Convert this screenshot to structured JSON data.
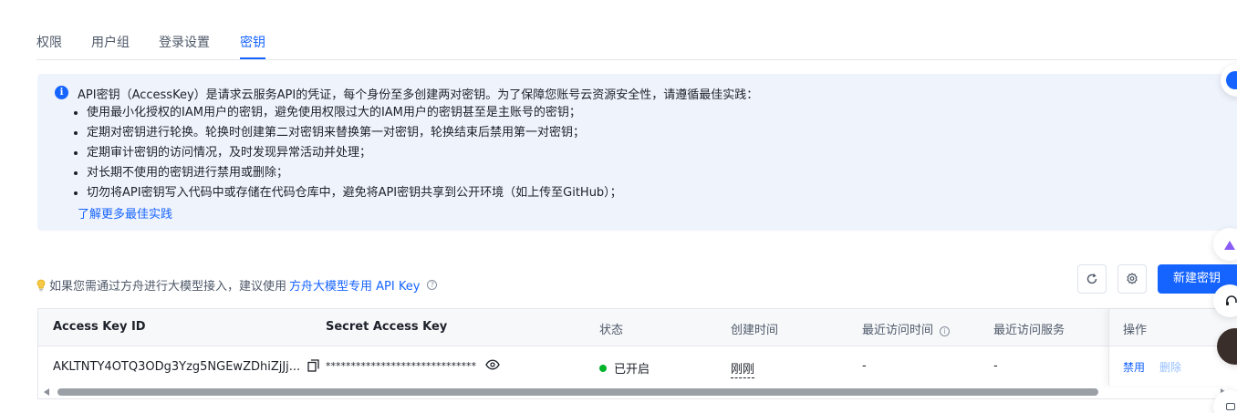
{
  "tabs": [
    {
      "label": "权限"
    },
    {
      "label": "用户组"
    },
    {
      "label": "登录设置"
    },
    {
      "label": "密钥"
    }
  ],
  "info": {
    "title": "API密钥（AccessKey）是请求云服务API的凭证，每个身份至多创建两对密钥。为了保障您账号云资源安全性，请遵循最佳实践：",
    "items": [
      "使用最小化授权的IAM用户的密钥，避免使用权限过大的IAM用户的密钥甚至是主账号的密钥；",
      "定期对密钥进行轮换。轮换时创建第二对密钥来替换第一对密钥，轮换结束后禁用第一对密钥；",
      "定期审计密钥的访问情况，及时发现异常活动并处理；",
      "对长期不使用的密钥进行禁用或删除；",
      "切勿将API密钥写入代码中或存储在代码仓库中，避免将API密钥共享到公开环境（如上传至GitHub）；"
    ],
    "link": "了解更多最佳实践"
  },
  "tip": {
    "prefix": "如果您需通过方舟进行大模型接入，建议使用",
    "link": "方舟大模型专用 API Key"
  },
  "toolbar": {
    "create_label": "新建密钥",
    "refresh_icon": "refresh-icon",
    "settings_icon": "gear-icon"
  },
  "table": {
    "headers": {
      "access_key_id": "Access Key ID",
      "secret_access_key": "Secret Access Key",
      "status": "状态",
      "created": "创建时间",
      "last_access_time": "最近访问时间",
      "last_access_service": "最近访问服务",
      "actions": "操作"
    },
    "rows": [
      {
        "access_key_id": "AKLTNTY4OTQ3ODg3Yzg5NGEwZDhiZjJj...",
        "secret": "******************************",
        "status": "已开启",
        "created": "刚刚",
        "last_access_time": "-",
        "last_access_service": "-",
        "action_disable": "禁用",
        "action_delete": "删除"
      }
    ]
  },
  "colors": {
    "accent": "#1664ff",
    "status_on": "#00b42a",
    "info_bg": "#eff3fc"
  }
}
